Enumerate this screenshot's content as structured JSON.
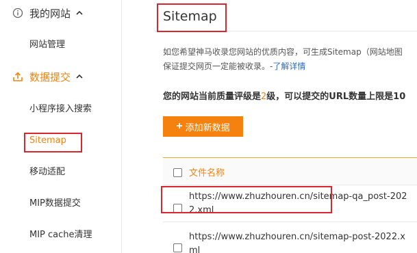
{
  "sidebar": {
    "group_site": {
      "label": "我的网站",
      "icon": "info-circle-icon"
    },
    "site_items": [
      {
        "label": "网站管理"
      }
    ],
    "group_data": {
      "label": "数据提交",
      "icon": "upload-icon"
    },
    "data_items": [
      {
        "label": "小程序接入搜索"
      },
      {
        "label": "Sitemap",
        "active": true
      },
      {
        "label": "移动适配"
      },
      {
        "label": "MIP数据提交"
      },
      {
        "label": "MIP cache清理"
      }
    ]
  },
  "main": {
    "title": "Sitemap",
    "description_line1": "如您希望神马收录您网站的优质内容，可生成Sitemap（网站地图",
    "description_line2": "保证提交网页一定能被收录。-",
    "description_link": "了解详情",
    "quality_prefix": "您的网站当前质量评级是",
    "quality_level": "2",
    "quality_suffix": "级，可以提交的URL数量上限是10",
    "add_button": "添加新数据",
    "table": {
      "column_header": "文件名称",
      "rows": [
        {
          "url": "https://www.zhuzhouren.cn/sitemap-qa_post-2022.xml"
        },
        {
          "url": "https://www.zhuzhouren.cn/sitemap-post-2022.xml"
        }
      ]
    }
  },
  "colors": {
    "accent": "#f5820e",
    "highlight_box": "#d9262c",
    "link": "#2d6bc4"
  }
}
